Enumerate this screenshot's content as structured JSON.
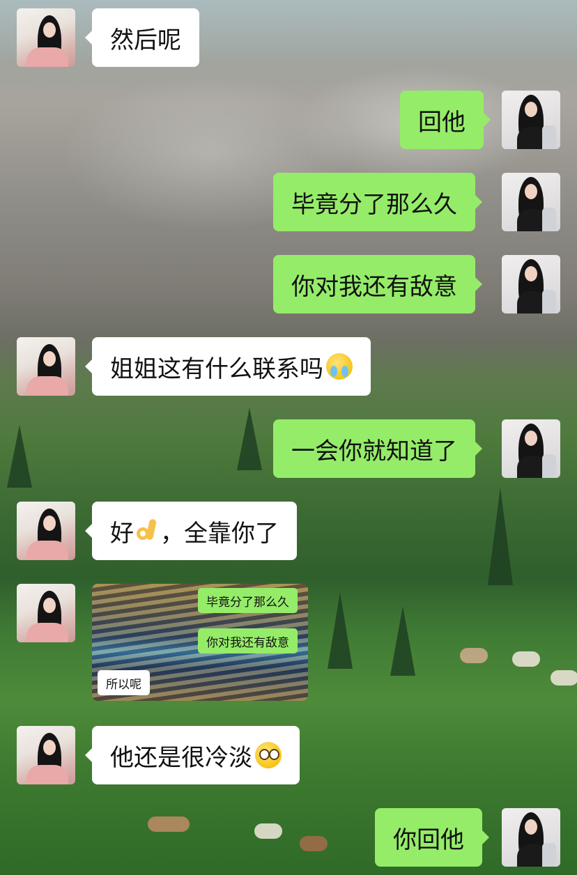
{
  "messages": [
    {
      "side": "left",
      "text": "然后呢"
    },
    {
      "side": "right",
      "text": "回他"
    },
    {
      "side": "right",
      "text": "毕竟分了那么久"
    },
    {
      "side": "right",
      "text": "你对我还有敌意"
    },
    {
      "side": "left",
      "text": "姐姐这有什么联系吗",
      "emoji": "crying-laughing-emoji"
    },
    {
      "side": "right",
      "text": "一会你就知道了"
    },
    {
      "side": "left",
      "text_before": "好",
      "emoji": "ok-hand-emoji",
      "text_after": "，全靠你了"
    },
    {
      "side": "left",
      "type": "image",
      "image": {
        "bubbles": [
          {
            "side": "right",
            "text": "毕竟分了那么久"
          },
          {
            "side": "right",
            "text": "你对我还有敌意"
          },
          {
            "side": "left",
            "text": "所以呢"
          }
        ]
      }
    },
    {
      "side": "left",
      "text": "他还是很冷淡",
      "emoji": "pleading-face-emoji"
    },
    {
      "side": "right",
      "text": "你回他"
    }
  ]
}
